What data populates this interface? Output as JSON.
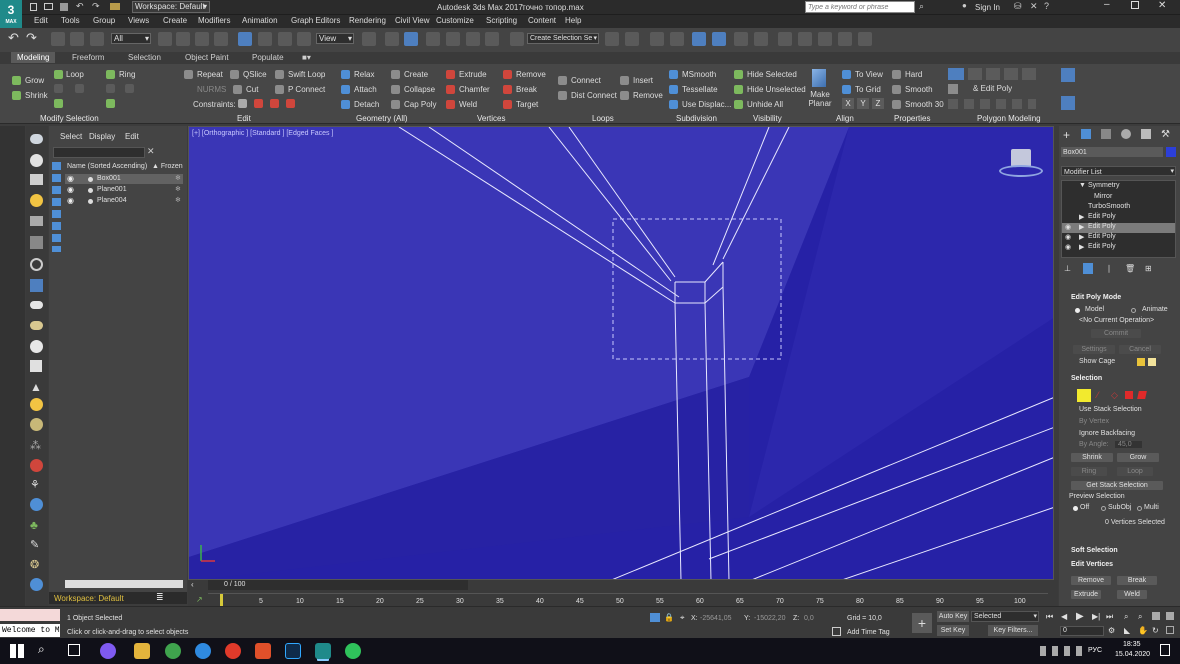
{
  "titlebar": {
    "workspace": "Workspace: Default",
    "app_title": "Autodesk 3ds Max 2017",
    "file_name": "точно топор.max",
    "search_placeholder": "Type a keyword or phrase",
    "sign_in": "Sign In"
  },
  "menu": [
    "Edit",
    "Tools",
    "Group",
    "Views",
    "Create",
    "Modifiers",
    "Animation",
    "Graph Editors",
    "Rendering",
    "Civil View",
    "Customize",
    "Scripting",
    "Content",
    "Help"
  ],
  "maintoolbar": {
    "filter": "All",
    "ref_coord": "View",
    "selection_set": "Create Selection Se"
  },
  "ribbon": {
    "tabs": [
      "Modeling",
      "Freeform",
      "Selection",
      "Object Paint",
      "Populate"
    ],
    "col_a": [
      "Grow",
      "Shrink"
    ],
    "loop_ring": [
      "Loop",
      "Ring"
    ],
    "edit_col1": [
      "Repeat",
      "NURMS",
      "Constraints:"
    ],
    "edit_col2": [
      "QSlice",
      "Cut",
      "P Connect"
    ],
    "edit_col3": [
      "Swift Loop"
    ],
    "geom_col1": [
      "Relax",
      "Attach",
      "Detach"
    ],
    "geom_col2": [
      "Create",
      "Collapse",
      "Cap Poly"
    ],
    "vert_col1": [
      "Extrude",
      "Chamfer",
      "Weld"
    ],
    "vert_col2": [
      "Remove",
      "Break",
      "Target"
    ],
    "loops_col1": [
      "Connect",
      "Dist Connect"
    ],
    "loops_col2": [
      "Insert",
      "Remove"
    ],
    "subdiv": [
      "MSmooth",
      "Tessellate",
      "Use Displac..."
    ],
    "vis": [
      "Hide Selected",
      "Hide Unselected",
      "Unhide All"
    ],
    "make_planar": "Make Planar",
    "align": [
      "To View",
      "To Grid"
    ],
    "xyz": [
      "X",
      "Y",
      "Z"
    ],
    "props": [
      "Hard",
      "Smooth",
      "Smooth 30"
    ],
    "polymod": "& Edit Poly",
    "groups": [
      "Modify Selection",
      "Edit",
      "Geometry (All)",
      "Vertices",
      "Loops",
      "Subdivision",
      "Visibility",
      "Align",
      "Properties",
      "Polygon Modeling"
    ]
  },
  "scene_explorer": {
    "tabs": [
      "Select",
      "Display",
      "Edit"
    ],
    "col_name": "Name (Sorted Ascending)",
    "col_frozen": "▲ Frozen",
    "objects": [
      "Box001",
      "Plane001",
      "Plane004"
    ],
    "workspace": "Workspace: Default"
  },
  "viewport": {
    "label": "[+] [Orthographic ] [Standard ] [Edged Faces ]"
  },
  "command_panel": {
    "object_name": "Box001",
    "modifier_list": "Modifier List",
    "stack": [
      "Symmetry",
      "Mirror",
      "TurboSmooth",
      "Edit Poly",
      "Edit Poly",
      "Edit Poly",
      "Edit Poly"
    ],
    "edit_poly_mode": "Edit Poly Mode",
    "model": "Model",
    "animate": "Animate",
    "no_op": "<No Current Operation>",
    "commit": "Commit",
    "settings": "Settings",
    "cancel": "Cancel",
    "show_cage": "Show Cage",
    "selection": "Selection",
    "use_stack": "Use Stack Selection",
    "by_vertex": "By Vertex",
    "ignore_backfacing": "Ignore Backfacing",
    "by_angle": "By Angle:",
    "angle_val": "45,0",
    "shrink": "Shrink",
    "grow": "Grow",
    "ring": "Ring",
    "loop": "Loop",
    "get_stack": "Get Stack Selection",
    "preview": "Preview Selection",
    "off": "Off",
    "subobj": "SubObj",
    "multi": "Multi",
    "vert_sel": "0 Vertices Selected",
    "soft_sel": "Soft Selection",
    "edit_vertices": "Edit Vertices",
    "remove": "Remove",
    "break": "Break",
    "extrude": "Extrude",
    "weld": "Weld"
  },
  "timeline": {
    "frame": "0 / 100",
    "ticks": [
      "5",
      "10",
      "15",
      "20",
      "25",
      "30",
      "35",
      "40",
      "45",
      "50",
      "55",
      "60",
      "65",
      "70",
      "75",
      "80",
      "85",
      "90",
      "95",
      "100"
    ]
  },
  "status": {
    "selected": "1 Object Selected",
    "hint": "Click or click-and-drag to select objects",
    "welcome": "Welcome to M",
    "x_label": "X:",
    "x_val": "-25641,05",
    "y_label": "Y:",
    "y_val": "-15022,20",
    "z_label": "Z:",
    "z_val": "0,0",
    "grid": "Grid = 10,0",
    "add_time_tag": "Add Time Tag",
    "auto_key": "Auto Key",
    "set_key": "Set Key",
    "selected_dd": "Selected",
    "key_filters": "Key Filters...",
    "frame_val": "0"
  },
  "taskbar": {
    "lang": "РУС",
    "time": "18:35",
    "date": "15.04.2020"
  }
}
